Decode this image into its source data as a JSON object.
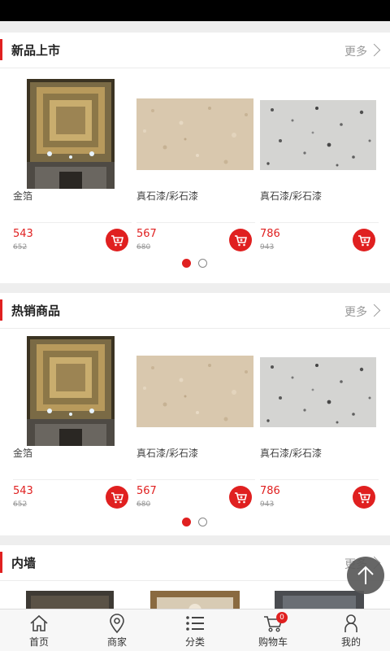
{
  "sections": [
    {
      "title": "新品上市",
      "more_label": "更多",
      "products": [
        {
          "name": "金箔",
          "price": "543",
          "old_price": "652",
          "image": "ceiling"
        },
        {
          "name": "真石漆/彩石漆",
          "price": "567",
          "old_price": "680",
          "image": "beige-texture"
        },
        {
          "name": "真石漆/彩石漆",
          "price": "786",
          "old_price": "943",
          "image": "granite-texture"
        }
      ],
      "pager": {
        "pages": 2,
        "active": 1
      }
    },
    {
      "title": "热销商品",
      "more_label": "更多",
      "products": [
        {
          "name": "金箔",
          "price": "543",
          "old_price": "652",
          "image": "ceiling"
        },
        {
          "name": "真石漆/彩石漆",
          "price": "567",
          "old_price": "680",
          "image": "beige-texture"
        },
        {
          "name": "真石漆/彩石漆",
          "price": "786",
          "old_price": "943",
          "image": "granite-texture"
        }
      ],
      "pager": {
        "pages": 2,
        "active": 1
      }
    },
    {
      "title": "内墙",
      "more_label": "更多"
    }
  ],
  "nav": [
    {
      "label": "首页",
      "icon": "home-icon"
    },
    {
      "label": "商家",
      "icon": "location-pin-icon"
    },
    {
      "label": "分类",
      "icon": "list-icon"
    },
    {
      "label": "购物车",
      "icon": "cart-icon",
      "badge": "0"
    },
    {
      "label": "我的",
      "icon": "user-icon"
    }
  ],
  "colors": {
    "accent": "#e02020",
    "background": "#eeeeee"
  }
}
